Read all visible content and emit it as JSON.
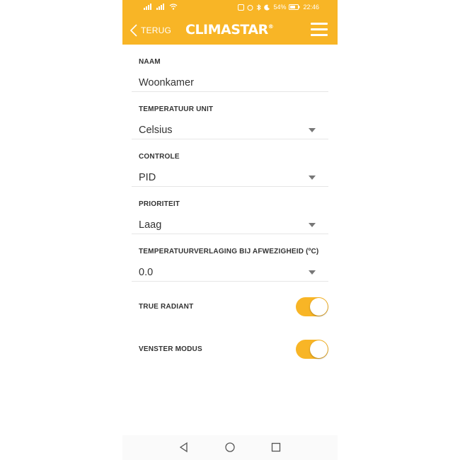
{
  "status_bar": {
    "battery": "54%",
    "time": "22:46"
  },
  "app_bar": {
    "back_label": "TERUG",
    "logo_text": "CLIMASTAR",
    "logo_mark": "®"
  },
  "form": {
    "fields": [
      {
        "label": "NAAM",
        "value": "Woonkamer"
      },
      {
        "label": "TEMPERATUUR UNIT",
        "value": "Celsius"
      },
      {
        "label": "CONTROLE",
        "value": "PID"
      },
      {
        "label": "PRIORITEIT",
        "value": "Laag"
      },
      {
        "label": "TEMPERATUURVERLAGING BIJ AFWEZIGHEID (ºC)",
        "value": "0.0"
      }
    ],
    "toggles": [
      {
        "label": "TRUE RADIANT",
        "on": true
      },
      {
        "label": "VENSTER MODUS",
        "on": true
      }
    ]
  },
  "colors": {
    "accent": "#f8b526",
    "text": "#333333",
    "divider": "#e6e6e6"
  }
}
